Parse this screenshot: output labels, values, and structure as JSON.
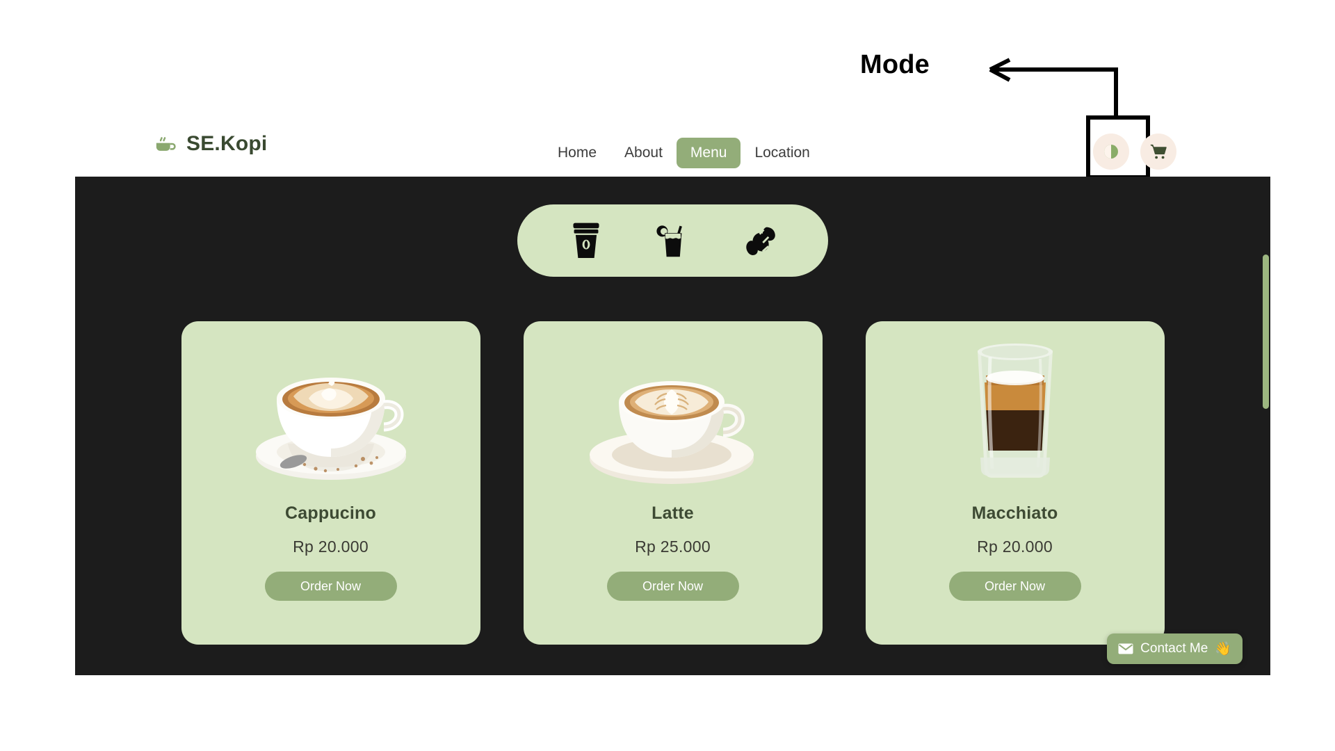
{
  "annotation": {
    "label": "Mode",
    "arrow_icon": "left-arrow-icon",
    "highlight_target": "theme-mode-toggle"
  },
  "header": {
    "brand": {
      "logo_icon": "coffee-cup-icon",
      "name": "SE.Kopi"
    },
    "nav": [
      {
        "label": "Home",
        "active": false
      },
      {
        "label": "About",
        "active": false
      },
      {
        "label": "Menu",
        "active": true
      },
      {
        "label": "Location",
        "active": false
      }
    ],
    "actions": [
      {
        "name": "theme-mode-toggle",
        "icon": "half-circle-contrast-icon"
      },
      {
        "name": "cart-button",
        "icon": "shopping-cart-icon"
      }
    ]
  },
  "categories": [
    {
      "name": "hot-coffee-category",
      "icon": "takeaway-coffee-cup-icon"
    },
    {
      "name": "cold-drink-category",
      "icon": "iced-drink-glass-icon"
    },
    {
      "name": "pastry-category",
      "icon": "croissant-icon"
    }
  ],
  "menu": {
    "order_button_label": "Order Now",
    "items": [
      {
        "name": "Cappucino",
        "price": "Rp 20.000",
        "image": "cappuccino-cup-photo"
      },
      {
        "name": "Latte",
        "price": "Rp 25.000",
        "image": "latte-cup-photo"
      },
      {
        "name": "Macchiato",
        "price": "Rp 20.000",
        "image": "macchiato-glass-photo"
      }
    ]
  },
  "floating": {
    "contact": {
      "icon": "envelope-icon",
      "label": "Contact Me",
      "emoji": "👋"
    }
  },
  "colors": {
    "panel_bg": "#1c1c1c",
    "card_bg": "#d5e5c1",
    "accent_green": "#93ad79",
    "brand_text": "#3a4a31",
    "icon_pill_bg": "#f8ece3",
    "scrollbar_thumb": "#9cb680"
  }
}
